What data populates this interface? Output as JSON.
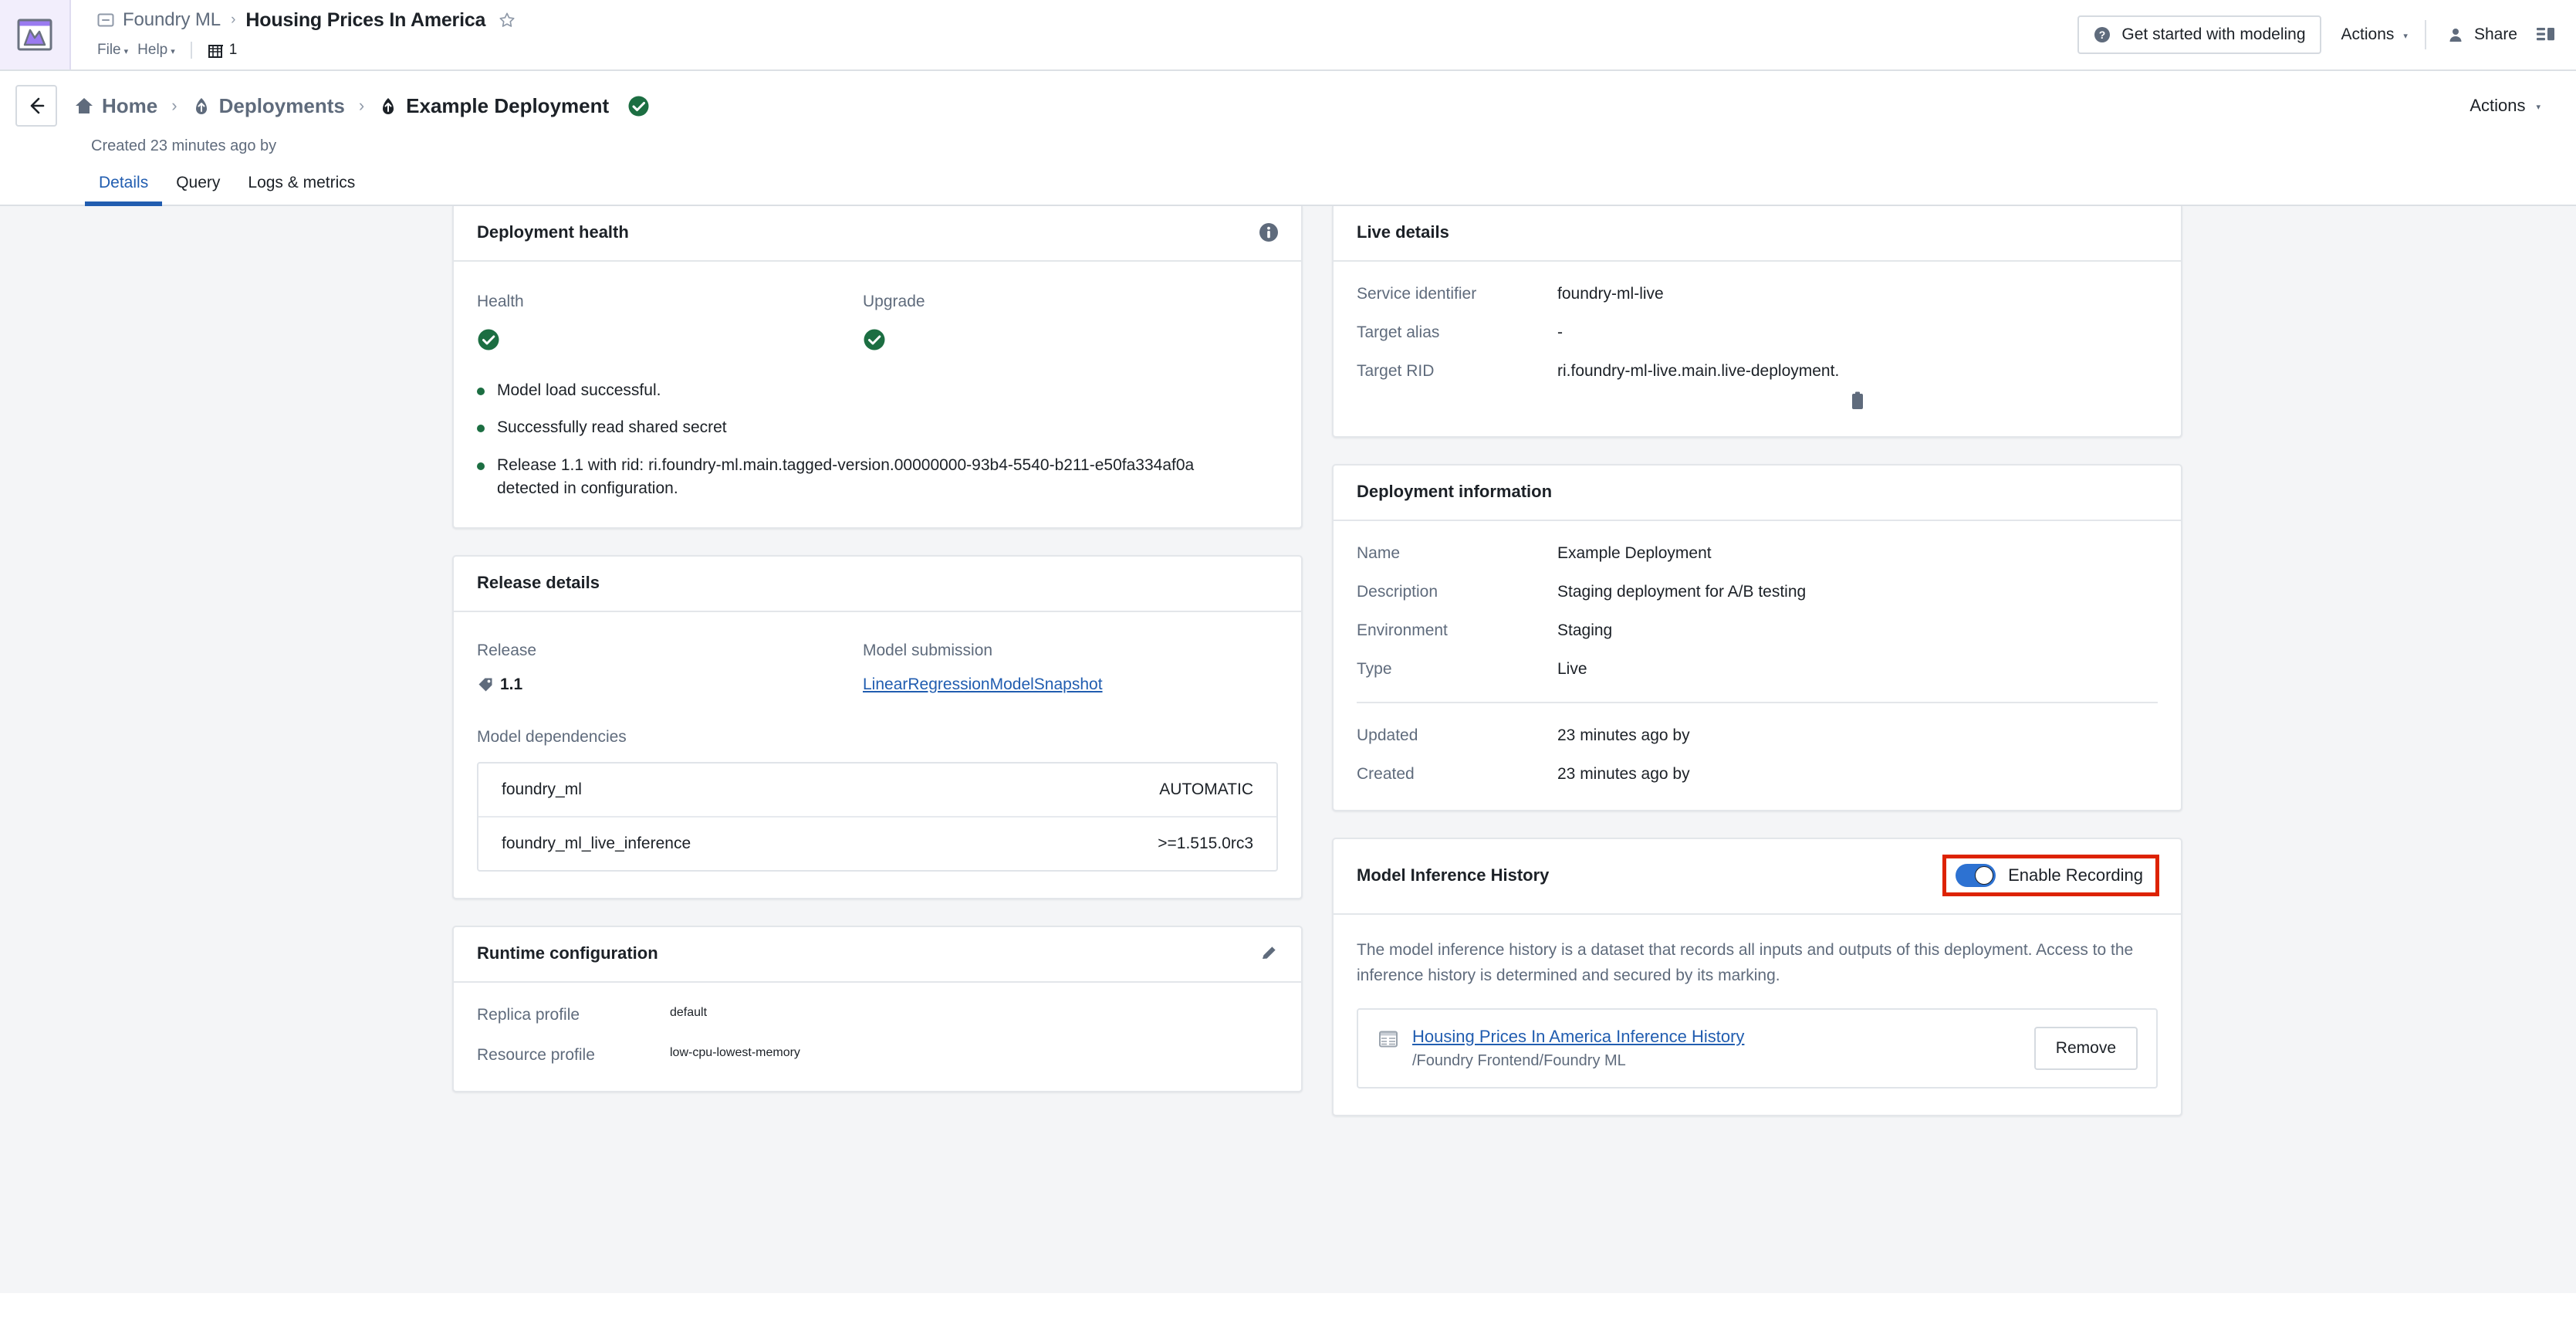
{
  "topbar": {
    "app_icon": "chart-window-icon",
    "breadcrumb_app": "Foundry ML",
    "breadcrumb_sep": "›",
    "title": "Housing Prices In America",
    "star_icon": "star-outline-icon",
    "menus": [
      {
        "label": "File",
        "caret": "▾"
      },
      {
        "label": "Help",
        "caret": "▾"
      }
    ],
    "building_icon": "building-icon",
    "building_count": "1",
    "get_started_label": "Get started with modeling",
    "help_icon": "question-circle-icon",
    "actions_label": "Actions",
    "actions_caret": "▾",
    "share_label": "Share",
    "person_icon": "person-icon",
    "panel_icon": "side-panel-icon"
  },
  "nav": {
    "back_icon": "arrow-left-icon",
    "crumbs": [
      {
        "icon": "home-icon",
        "label": "Home"
      },
      {
        "icon": "deployment-icon",
        "label": "Deployments"
      },
      {
        "icon": "deployment-icon",
        "label": "Example Deployment"
      }
    ],
    "chevron": "›",
    "status_icon": "check-circle-icon",
    "actions_label": "Actions",
    "actions_caret": "▾",
    "created_text": "Created 23 minutes ago by",
    "tabs": [
      {
        "label": "Details",
        "active": true
      },
      {
        "label": "Query",
        "active": false
      },
      {
        "label": "Logs & metrics",
        "active": false
      }
    ]
  },
  "deployment_health": {
    "title": "Deployment health",
    "info_icon": "info-circle-icon",
    "health_label": "Health",
    "upgrade_label": "Upgrade",
    "health_status_icon": "check-circle-icon",
    "upgrade_status_icon": "check-circle-icon",
    "bullets": [
      "Model load successful.",
      "Successfully read shared secret",
      "Release 1.1 with rid: ri.foundry-ml.main.tagged-version.00000000-93b4-5540-b211-e50fa334af0a detected in configuration."
    ]
  },
  "release_details": {
    "title": "Release details",
    "release_label": "Release",
    "release_value": "1.1",
    "tag_icon": "tag-icon",
    "model_submission_label": "Model submission",
    "model_submission_value": "LinearRegressionModelSnapshot",
    "dependencies_label": "Model dependencies",
    "dependencies": [
      {
        "name": "foundry_ml",
        "version": "AUTOMATIC"
      },
      {
        "name": "foundry_ml_live_inference",
        "version": ">=1.515.0rc3"
      }
    ]
  },
  "runtime_configuration": {
    "title": "Runtime configuration",
    "edit_icon": "pencil-icon",
    "rows": [
      {
        "key": "Replica profile",
        "value": "default"
      },
      {
        "key": "Resource profile",
        "value": "low-cpu-lowest-memory"
      }
    ]
  },
  "live_details": {
    "title": "Live details",
    "rows": [
      {
        "key": "Service identifier",
        "value": "foundry-ml-live"
      },
      {
        "key": "Target alias",
        "value": "-"
      },
      {
        "key": "Target RID",
        "value": "ri.foundry-ml-live.main.live-deployment."
      }
    ],
    "copy_icon": "clipboard-icon"
  },
  "deployment_information": {
    "title": "Deployment information",
    "rows_top": [
      {
        "key": "Name",
        "value": "Example Deployment"
      },
      {
        "key": "Description",
        "value": "Staging deployment for A/B testing"
      },
      {
        "key": "Environment",
        "value": "Staging"
      },
      {
        "key": "Type",
        "value": "Live"
      }
    ],
    "rows_bottom": [
      {
        "key": "Updated",
        "value": "23 minutes ago by"
      },
      {
        "key": "Created",
        "value": "23 minutes ago by"
      }
    ]
  },
  "model_inference_history": {
    "title": "Model Inference History",
    "toggle_label": "Enable Recording",
    "toggle_on": true,
    "highlight_color": "#dd2200",
    "toggle_color": "#2d72d2",
    "description": "The model inference history is a dataset that records all inputs and outputs of this deployment. Access to the inference history is determined and secured by its marking.",
    "dataset_icon": "dataset-table-icon",
    "dataset_name": "Housing Prices In America Inference History",
    "dataset_path": "/Foundry Frontend/Foundry ML",
    "remove_label": "Remove"
  }
}
